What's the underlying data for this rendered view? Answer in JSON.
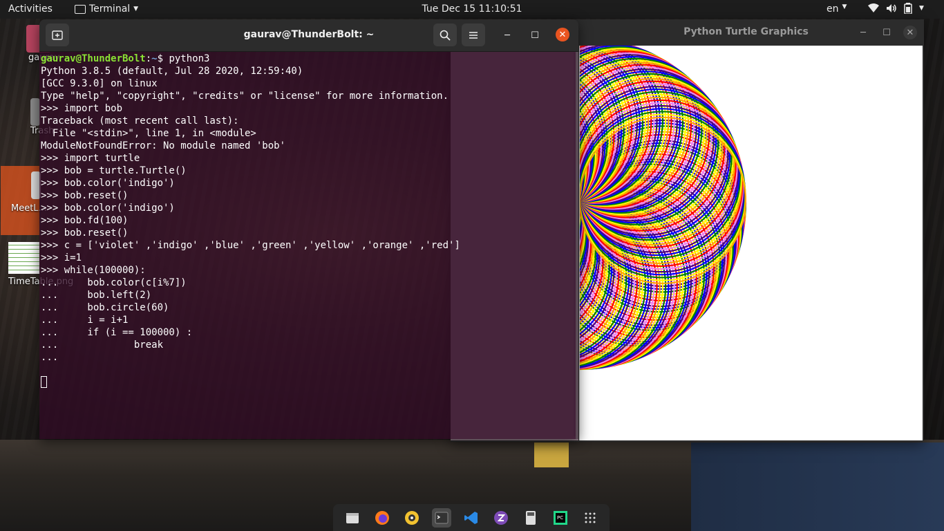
{
  "topbar": {
    "activities": "Activities",
    "app_name": "Terminal",
    "clock": "Tue Dec 15  11:10:51",
    "language": "en"
  },
  "desktop_icons": [
    {
      "label": "gaurav",
      "icon": "home-folder-icon"
    },
    {
      "label": "Trash",
      "icon": "trash-icon"
    },
    {
      "label": "MeetL...",
      "icon": "file-icon"
    },
    {
      "label": "TimeTable.png",
      "icon": "image-thumbnail-icon"
    }
  ],
  "terminal": {
    "title": "gaurav@ThunderBolt: ~",
    "prompt_user": "gaurav@ThunderBolt",
    "prompt_sep": ":",
    "prompt_path": "~",
    "first_command": "$ python3",
    "lines": [
      "Python 3.8.5 (default, Jul 28 2020, 12:59:40)",
      "[GCC 9.3.0] on linux",
      "Type \"help\", \"copyright\", \"credits\" or \"license\" for more information.",
      ">>> import bob",
      "Traceback (most recent call last):",
      "  File \"<stdin>\", line 1, in <module>",
      "ModuleNotFoundError: No module named 'bob'",
      ">>> import turtle",
      ">>> bob = turtle.Turtle()",
      ">>> bob.color('indigo')",
      ">>> bob.reset()",
      ">>> bob.color('indigo')",
      ">>> bob.fd(100)",
      ">>> bob.reset()",
      ">>> c = ['violet' ,'indigo' ,'blue' ,'green' ,'yellow' ,'orange' ,'red']",
      ">>> i=1",
      ">>> while(100000):",
      "...     bob.color(c[i%7])",
      "...     bob.left(2)",
      "...     bob.circle(60)",
      "...     i = i+1",
      "...     if (i == 100000) :",
      "...             break",
      "..."
    ]
  },
  "turtle_window": {
    "title": "Python Turtle Graphics"
  },
  "drawing": {
    "colors": [
      "#ee82ee",
      "#4b0082",
      "#0000ff",
      "#008000",
      "#ffff00",
      "#ffa500",
      "#ff0000"
    ]
  },
  "dock": {
    "items": [
      "files-icon",
      "firefox-icon",
      "rhythmbox-icon",
      "terminal-icon",
      "vscode-icon",
      "emacs-icon",
      "calculator-icon",
      "pycharm-icon",
      "app-grid-icon"
    ]
  }
}
